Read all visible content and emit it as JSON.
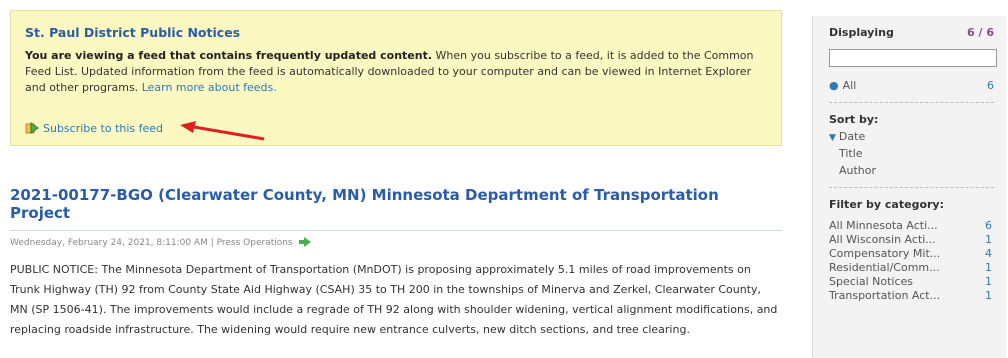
{
  "notice": {
    "title": "St. Paul District Public Notices",
    "bold_text": "You are viewing a feed that contains frequently updated content.",
    "body_text": " When you subscribe to a feed, it is added to the Common Feed List. Updated information from the feed is automatically downloaded to your computer and can be viewed in Internet Explorer and other programs.",
    "learn_more": "Learn more about feeds.",
    "subscribe_label": "Subscribe to this feed"
  },
  "article": {
    "title": "2021-00177-BGO (Clearwater County, MN) Minnesota Department of Transportation Project",
    "meta": "Wednesday, February 24, 2021, 8:11:00 AM | Press Operations",
    "body": "PUBLIC NOTICE: The Minnesota Department of Transportation (MnDOT) is proposing approximately 5.1 miles of road improvements on Trunk Highway (TH) 92 from County State Aid Highway (CSAH) 35 to TH 200 in the townships of Minerva and Zerkel, Clearwater County, MN (SP 1506-41). The improvements would include a regrade of TH 92 along with shoulder widening, vertical alignment modifications, and replacing roadside infrastructure. The widening would require new entrance culverts, new ditch sections, and tree clearing."
  },
  "sidebar": {
    "displaying_label": "Displaying",
    "displaying_count": "6 / 6",
    "all_label": "All",
    "all_count": "6",
    "sort_heading": "Sort by:",
    "sort_options": [
      "Date",
      "Title",
      "Author"
    ],
    "filter_heading": "Filter by category:",
    "categories": [
      {
        "label": "All Minnesota Acti...",
        "count": "6"
      },
      {
        "label": "All Wisconsin Acti...",
        "count": "1"
      },
      {
        "label": "Compensatory Mit...",
        "count": "4"
      },
      {
        "label": "Residential/Comm...",
        "count": "1"
      },
      {
        "label": "Special Notices",
        "count": "1"
      },
      {
        "label": "Transportation Act...",
        "count": "1"
      }
    ]
  },
  "colors": {
    "notice_bg": "#fcf8c2",
    "link_blue": "#2a7ab8",
    "title_blue": "#2a5da8",
    "annotation_arrow": "#e02020"
  },
  "icons": {
    "subscribe": "feed-subscribe-icon",
    "meta_arrow": "green-arrow-icon",
    "annotation": "red-pointer-arrow"
  }
}
